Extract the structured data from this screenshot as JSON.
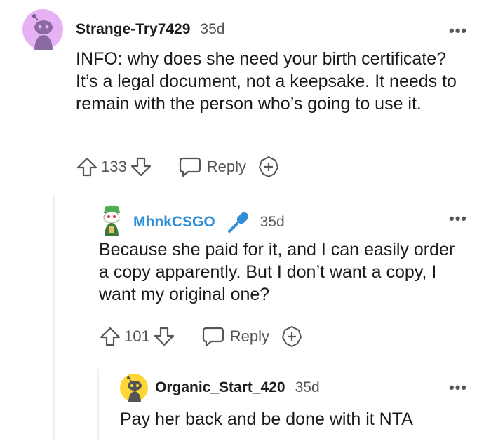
{
  "comments": [
    {
      "author": "Strange-Try7429",
      "age": "35d",
      "body": "INFO: why does she need your birth certificate? It’s a legal document, not a keepsake. It needs to remain with the person who’s going to use it.",
      "votes": "133",
      "reply_label": "Reply",
      "more_label": "•••"
    },
    {
      "author": "MhnkCSGO",
      "age": "35d",
      "body": "Because she paid for it, and I can easily order a copy apparently. But I don’t want a copy, I want my original one?",
      "votes": "101",
      "reply_label": "Reply",
      "more_label": "•••"
    },
    {
      "author": "Organic_Start_420",
      "age": "35d",
      "body": "Pay her back and be done with it NTA",
      "more_label": "•••"
    }
  ],
  "colors": {
    "avatar1_bg": "#e7b2f5",
    "avatar3_bg": "#ffd635",
    "flair_blue": "#2f8ed6"
  },
  "icons": {
    "avatar1": "snoo-avatar-icon",
    "avatar2": "snoo-green-avatar-icon",
    "avatar3": "snoo-yellow-avatar-icon",
    "flair": "microphone-icon",
    "upvote": "upvote-arrow-icon",
    "downvote": "downvote-arrow-icon",
    "reply": "speech-bubble-icon",
    "award": "award-plus-icon"
  }
}
